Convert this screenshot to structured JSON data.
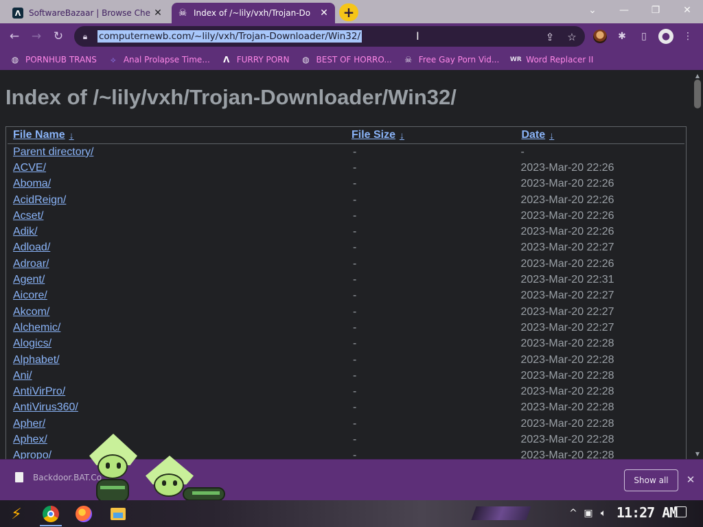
{
  "tabs": [
    {
      "title": "SoftwareBazaar | Browse Che",
      "icon": "softwarebazaar-logo-icon",
      "active": false
    },
    {
      "title": "Index of /~lily/vxh/Trojan-Do",
      "icon": "skull-icon",
      "active": true
    }
  ],
  "toolbar": {
    "url": "computernewb.com/~lily/vxh/Trojan-Downloader/Win32/"
  },
  "bookmarks": [
    {
      "label": "PORNHUB TRANS",
      "icon": "globe-icon"
    },
    {
      "label": "Anal Prolapse Time...",
      "icon": "bookmark-icon"
    },
    {
      "label": "FURRY PORN",
      "icon": "softwarebazaar-logo-icon"
    },
    {
      "label": "BEST OF HORRO...",
      "icon": "globe-icon"
    },
    {
      "label": "Free Gay Porn Vid...",
      "icon": "skull-icon"
    },
    {
      "label": "Word Replacer II",
      "icon": "word-replacer-icon"
    }
  ],
  "page": {
    "heading": "Index of /~lily/vxh/Trojan-Downloader/Win32/",
    "columns": {
      "name": "File Name",
      "size": "File Size",
      "date": "Date",
      "sort_glyph": "↓"
    },
    "rows": [
      {
        "name": "Parent directory/",
        "size": "-",
        "date": "-"
      },
      {
        "name": "ACVE/",
        "size": "-",
        "date": "2023-Mar-20 22:26"
      },
      {
        "name": "Aboma/",
        "size": "-",
        "date": "2023-Mar-20 22:26"
      },
      {
        "name": "AcidReign/",
        "size": "-",
        "date": "2023-Mar-20 22:26"
      },
      {
        "name": "Acset/",
        "size": "-",
        "date": "2023-Mar-20 22:26"
      },
      {
        "name": "Adik/",
        "size": "-",
        "date": "2023-Mar-20 22:26"
      },
      {
        "name": "Adload/",
        "size": "-",
        "date": "2023-Mar-20 22:27"
      },
      {
        "name": "Adroar/",
        "size": "-",
        "date": "2023-Mar-20 22:26"
      },
      {
        "name": "Agent/",
        "size": "-",
        "date": "2023-Mar-20 22:31"
      },
      {
        "name": "Aicore/",
        "size": "-",
        "date": "2023-Mar-20 22:27"
      },
      {
        "name": "Akcom/",
        "size": "-",
        "date": "2023-Mar-20 22:27"
      },
      {
        "name": "Alchemic/",
        "size": "-",
        "date": "2023-Mar-20 22:27"
      },
      {
        "name": "Alogics/",
        "size": "-",
        "date": "2023-Mar-20 22:28"
      },
      {
        "name": "Alphabet/",
        "size": "-",
        "date": "2023-Mar-20 22:28"
      },
      {
        "name": "Ani/",
        "size": "-",
        "date": "2023-Mar-20 22:28"
      },
      {
        "name": "AntiVirPro/",
        "size": "-",
        "date": "2023-Mar-20 22:28"
      },
      {
        "name": "AntiVirus360/",
        "size": "-",
        "date": "2023-Mar-20 22:28"
      },
      {
        "name": "Apher/",
        "size": "-",
        "date": "2023-Mar-20 22:28"
      },
      {
        "name": "Aphex/",
        "size": "-",
        "date": "2023-Mar-20 22:28"
      },
      {
        "name": "Apropo/",
        "size": "-",
        "date": "2023-Mar-20 22:28"
      }
    ]
  },
  "download_shelf": {
    "file_name": "Backdoor.BAT.Co...",
    "show_all_label": "Show all"
  },
  "taskbar": {
    "clock": "11:27 AM"
  },
  "colors": {
    "chrome_theme": "#5d2f78",
    "link": "#8ab4f8",
    "bookmark_text": "#ff88e8",
    "new_tab_button": "#f5c518"
  }
}
